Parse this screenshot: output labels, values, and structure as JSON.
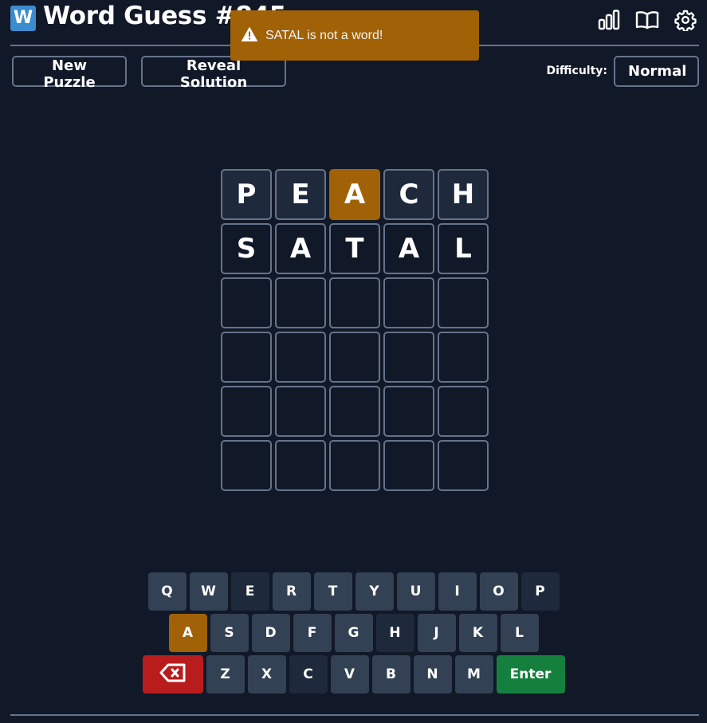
{
  "header": {
    "logo_letter": "W",
    "title": "Word Guess #845",
    "icons": [
      "stats-icon",
      "book-icon",
      "gear-icon"
    ]
  },
  "toolbar": {
    "new_puzzle_label": "New Puzzle",
    "reveal_label": "Reveal Solution",
    "difficulty_label": "Difficulty:",
    "difficulty_value": "Normal"
  },
  "toast": {
    "icon": "warning-icon",
    "message": "SATAL is not a word!",
    "color": "#a16207"
  },
  "colors": {
    "present": "#a16207",
    "absent": "#1e293b",
    "default_key": "#334155",
    "backspace": "#b91c1c",
    "enter": "#15803d"
  },
  "board": {
    "rows": [
      [
        {
          "letter": "P",
          "state": "absent"
        },
        {
          "letter": "E",
          "state": "absent"
        },
        {
          "letter": "A",
          "state": "present"
        },
        {
          "letter": "C",
          "state": "absent"
        },
        {
          "letter": "H",
          "state": "absent"
        }
      ],
      [
        {
          "letter": "S",
          "state": "typed"
        },
        {
          "letter": "A",
          "state": "typed"
        },
        {
          "letter": "T",
          "state": "typed"
        },
        {
          "letter": "A",
          "state": "typed"
        },
        {
          "letter": "L",
          "state": "typed"
        }
      ],
      [
        {
          "letter": "",
          "state": "empty"
        },
        {
          "letter": "",
          "state": "empty"
        },
        {
          "letter": "",
          "state": "empty"
        },
        {
          "letter": "",
          "state": "empty"
        },
        {
          "letter": "",
          "state": "empty"
        }
      ],
      [
        {
          "letter": "",
          "state": "empty"
        },
        {
          "letter": "",
          "state": "empty"
        },
        {
          "letter": "",
          "state": "empty"
        },
        {
          "letter": "",
          "state": "empty"
        },
        {
          "letter": "",
          "state": "empty"
        }
      ],
      [
        {
          "letter": "",
          "state": "empty"
        },
        {
          "letter": "",
          "state": "empty"
        },
        {
          "letter": "",
          "state": "empty"
        },
        {
          "letter": "",
          "state": "empty"
        },
        {
          "letter": "",
          "state": "empty"
        }
      ],
      [
        {
          "letter": "",
          "state": "empty"
        },
        {
          "letter": "",
          "state": "empty"
        },
        {
          "letter": "",
          "state": "empty"
        },
        {
          "letter": "",
          "state": "empty"
        },
        {
          "letter": "",
          "state": "empty"
        }
      ]
    ]
  },
  "keyboard": {
    "rows": [
      [
        {
          "key": "Q",
          "state": "unused"
        },
        {
          "key": "W",
          "state": "unused"
        },
        {
          "key": "E",
          "state": "absent"
        },
        {
          "key": "R",
          "state": "unused"
        },
        {
          "key": "T",
          "state": "unused"
        },
        {
          "key": "Y",
          "state": "unused"
        },
        {
          "key": "U",
          "state": "unused"
        },
        {
          "key": "I",
          "state": "unused"
        },
        {
          "key": "O",
          "state": "unused"
        },
        {
          "key": "P",
          "state": "absent"
        }
      ],
      [
        {
          "key": "A",
          "state": "present"
        },
        {
          "key": "S",
          "state": "unused"
        },
        {
          "key": "D",
          "state": "unused"
        },
        {
          "key": "F",
          "state": "unused"
        },
        {
          "key": "G",
          "state": "unused"
        },
        {
          "key": "H",
          "state": "absent"
        },
        {
          "key": "J",
          "state": "unused"
        },
        {
          "key": "K",
          "state": "unused"
        },
        {
          "key": "L",
          "state": "unused"
        }
      ],
      [
        {
          "key": "",
          "state": "backspace"
        },
        {
          "key": "Z",
          "state": "unused"
        },
        {
          "key": "X",
          "state": "unused"
        },
        {
          "key": "C",
          "state": "absent"
        },
        {
          "key": "V",
          "state": "unused"
        },
        {
          "key": "B",
          "state": "unused"
        },
        {
          "key": "N",
          "state": "unused"
        },
        {
          "key": "M",
          "state": "unused"
        },
        {
          "key": "Enter",
          "state": "enter"
        }
      ]
    ]
  }
}
